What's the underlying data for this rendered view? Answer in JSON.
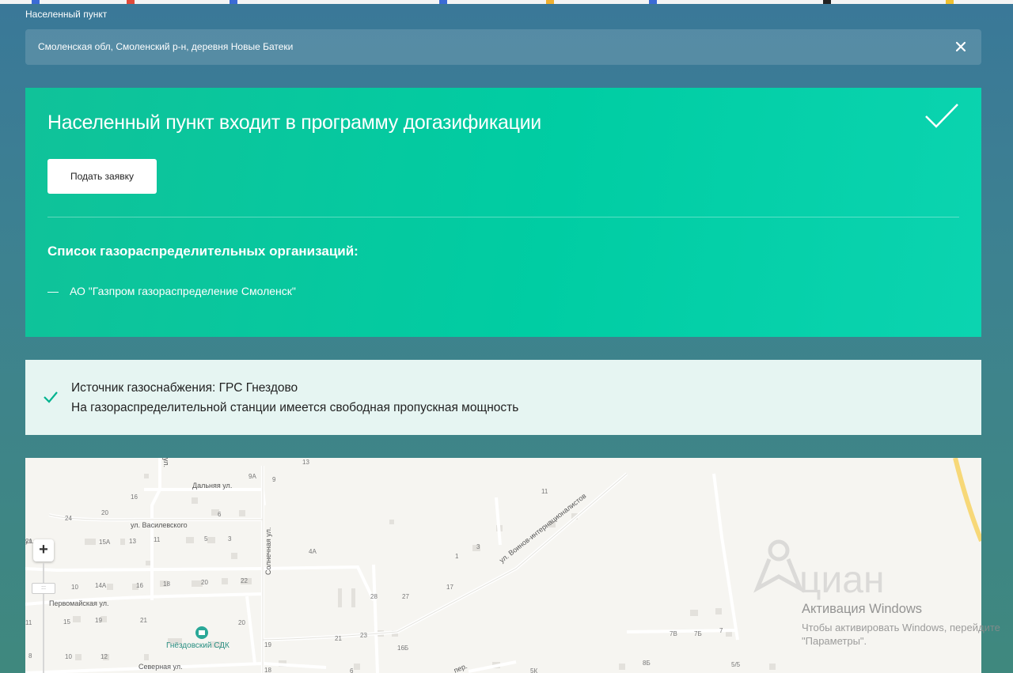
{
  "form": {
    "field_label": "Населенный пункт",
    "address_value": "Смоленская обл, Смоленский р-н, деревня Новые Батеки",
    "clear_icon": "close-icon"
  },
  "result": {
    "title": "Населенный пункт входит в программу догазификации",
    "status_icon": "checkmark-icon",
    "apply_button": "Подать заявку",
    "orgs_heading": "Список газораспределительных организаций:",
    "orgs": [
      "АО \"Газпром газораспределение Смоленск\""
    ],
    "colors": {
      "card": "#00cda3",
      "source_box": "#e6f5f2",
      "check": "#00b38f"
    }
  },
  "gas_source": {
    "source_line": "Источник газоснабжения: ГРС Гнездово",
    "capacity_line": "На газораспределительной станции имеется свободная пропускная мощность",
    "icon": "checkmark-icon"
  },
  "map": {
    "zoom_in_label": "+",
    "zoom_handle_label": ":::",
    "streets": [
      "Дальняя ул.",
      "ул. Василевского",
      "Солнечная ул.",
      "ул. Воинов-интернационалистов",
      "Первомайская ул.",
      "Северная ул.",
      "пер.",
      "ул."
    ],
    "poi": "Гнёздовский СДК",
    "house_numbers": [
      "13",
      "9А",
      "9",
      "16",
      "20",
      "24",
      "ул.",
      "6",
      "11",
      "15А",
      "13",
      "11",
      "5",
      "3",
      "4А",
      "3",
      "1",
      "21",
      "10",
      "14А",
      "16",
      "18",
      "20",
      "22",
      "28",
      "27",
      "17",
      "11",
      "15",
      "19",
      "21",
      "20",
      "19",
      "21",
      "23",
      "16Б",
      "8",
      "10",
      "12",
      "18",
      "6",
      "5К",
      "8Б",
      "5/5",
      "7В",
      "7Б",
      "7"
    ],
    "brand_watermark": "циан"
  },
  "os_overlay": {
    "title": "Активация Windows",
    "subtitle": "Чтобы активировать Windows, перейдите\n\"Параметры\"."
  }
}
